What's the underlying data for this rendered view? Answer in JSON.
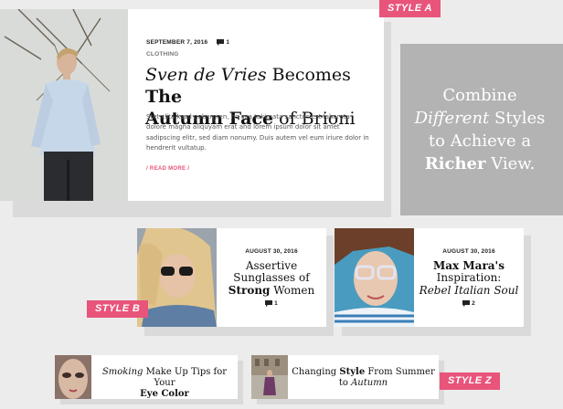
{
  "labels": {
    "style_a": "STYLE A",
    "style_b": "STYLE B",
    "style_z": "STYLE Z"
  },
  "featured": {
    "date": "SEPTEMBER 7, 2016",
    "comments": "1",
    "category": "CLOTHING",
    "title_italic": "Sven de Vries",
    "title_mid": " Becomes ",
    "title_bold1": "The",
    "title_bold2": "Autumn Face",
    "title_end": " of Brioni",
    "excerpt": "Stet clita kasd gubergren, no sea takimata sanctus est laboreta dolore magna aliquyam erat and lorem ipsum dolor sit amet sadipscing elitr, sed diam nonumy. Duis autem vel eum iriure dolor in hendrerit vultatup.",
    "read_more": "/ READ MORE /"
  },
  "promo": {
    "line1": "Combine",
    "line2_italic": "Different",
    "line2_rest": " Styles",
    "line3": "to Achieve a",
    "line4_bold": "Richer",
    "line4_rest": " View."
  },
  "card_b1": {
    "date": "AUGUST 30, 2016",
    "title_l1": "Assertive",
    "title_l2": "Sunglasses of",
    "title_bold": "Strong",
    "title_end": " Women",
    "comments": "1"
  },
  "card_b2": {
    "date": "AUGUST 30, 2016",
    "title_l1": "Max Mara's",
    "title_l2": "Inspiration:",
    "title_italic": "Rebel Italian Soul",
    "comments": "2"
  },
  "card_z1": {
    "title_italic": "Smoking",
    "title_rest": " Make Up Tips for Your",
    "title_bold": "Eye Color"
  },
  "card_z2": {
    "title_start": "Changing ",
    "title_bold": "Style",
    "title_mid": " From Summer",
    "title_pre": "to ",
    "title_italic": "Autumn"
  },
  "colors": {
    "accent": "#e8547a",
    "promo_bg": "#b3b3b3",
    "shadow": "#dadada"
  }
}
